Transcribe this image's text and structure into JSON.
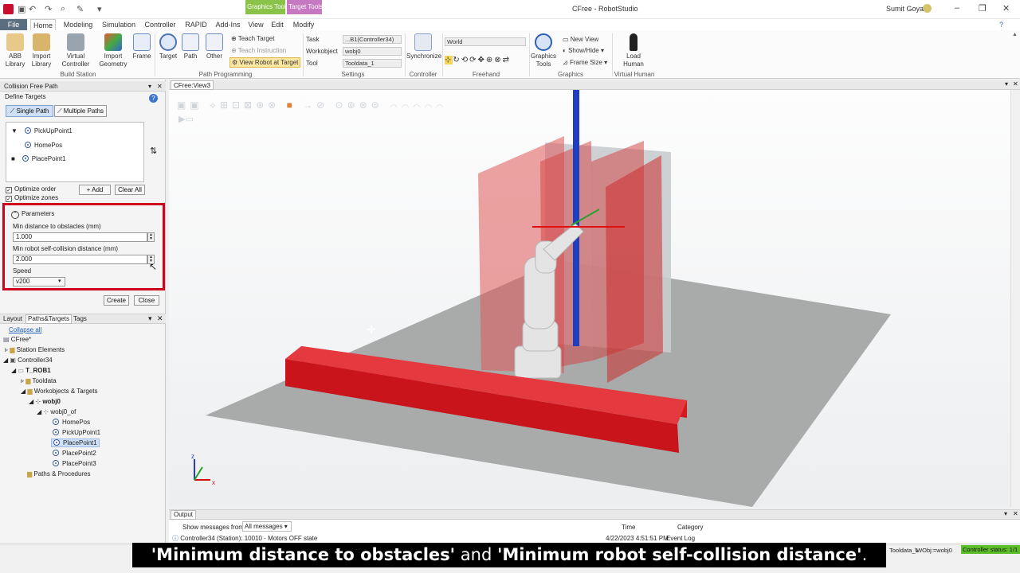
{
  "window": {
    "title": "CFree - RobotStudio",
    "user": "Sumit Goyal",
    "contextual_tabs": [
      "Graphics Tools",
      "Target Tools"
    ]
  },
  "ribbon_tabs": [
    "File",
    "Home",
    "Modeling",
    "Simulation",
    "Controller",
    "RAPID",
    "Add-Ins",
    "View",
    "Edit",
    "Modify"
  ],
  "ribbon": {
    "build_station": {
      "label": "Build Station",
      "abb_library": "ABB Library",
      "import_library": "Import Library",
      "virtual_controller": "Virtual Controller",
      "import_geometry": "Import Geometry",
      "frame": "Frame"
    },
    "path_programming": {
      "label": "Path Programming",
      "target": "Target",
      "path": "Path",
      "other": "Other",
      "teach_target": "Teach Target",
      "teach_instruction": "Teach Instruction",
      "view_robot_at_target": "View Robot at Target"
    },
    "settings": {
      "label": "Settings",
      "task_label": "Task",
      "task_value": "...B1(Controller34)",
      "workobject_label": "Workobject",
      "workobject_value": "wobj0",
      "tool_label": "Tool",
      "tool_value": "Tooldata_1"
    },
    "controller": {
      "label": "Controller",
      "synchronize": "Synchronize"
    },
    "freehand": {
      "label": "Freehand",
      "frame_value": "World"
    },
    "graphics": {
      "label": "Graphics",
      "graphics_tools": "Graphics Tools",
      "new_view": "New View",
      "show_hide": "Show/Hide",
      "frame_size": "Frame Size"
    },
    "virtual_human": {
      "label": "Virtual Human",
      "load_human": "Load Human"
    }
  },
  "collision_free_path": {
    "title": "Collision Free Path",
    "define_targets": "Define Targets",
    "single_path": "Single Path",
    "multiple_paths": "Multiple Paths",
    "targets": [
      "PickUpPoint1",
      "HomePos",
      "PlacePoint1"
    ],
    "optimize_order": "Optimize order",
    "optimize_zones": "Optimize zones",
    "add": "Add",
    "clear_all": "Clear All",
    "parameters": "Parameters",
    "min_obstacle_label": "Min distance to obstacles (mm)",
    "min_obstacle_value": "1.000",
    "min_self_label": "Min robot self-collision distance (mm)",
    "min_self_value": "2.000",
    "speed_label": "Speed",
    "speed_value": "v200",
    "create": "Create",
    "close": "Close"
  },
  "browser": {
    "tabs": [
      "Layout",
      "Paths&Targets",
      "Tags"
    ],
    "collapse_all": "Collapse all",
    "tree": [
      "CFree*",
      "Station Elements",
      "Controller34",
      "T_ROB1",
      "Tooldata",
      "Workobjects & Targets",
      "wobj0",
      "wobj0_of",
      "HomePos",
      "PickUpPoint1",
      "PlacePoint1",
      "PlacePoint2",
      "PlacePoint3",
      "Paths & Procedures"
    ]
  },
  "view": {
    "tab": "CFree:View3"
  },
  "output": {
    "title": "Output",
    "show_from_label": "Show messages from:",
    "show_from_value": "All messages",
    "col_time": "Time",
    "col_category": "Category",
    "row_message": "Controller34 (Station): 10010 - Motors OFF state",
    "row_time": "4/22/2023 4:51:51 PM",
    "row_category": "Event Log"
  },
  "status": {
    "tooldata": "Tooldata_1",
    "wobj": "\\WObj:=wobj0",
    "controller_status": "Controller status: 1/1"
  },
  "caption": {
    "q1": "'Minimum distance to obstacles'",
    "and": " and ",
    "q2": "'Minimum robot self-collision distance'",
    "end": "."
  },
  "colors": {
    "accent_red": "#d0021b",
    "controller_green": "#5cbf2a",
    "file_tab": "#5b6e7f"
  }
}
